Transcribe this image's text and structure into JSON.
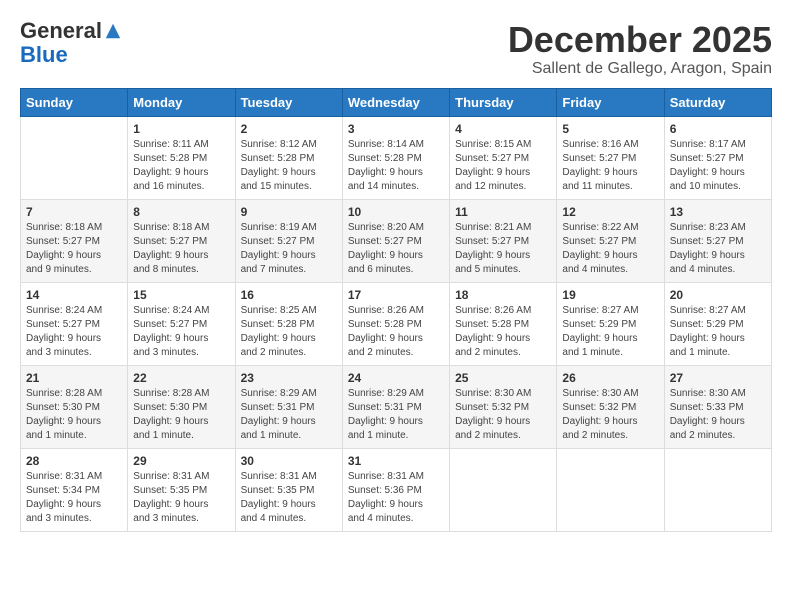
{
  "logo": {
    "general": "General",
    "blue": "Blue"
  },
  "header": {
    "month_year": "December 2025",
    "location": "Sallent de Gallego, Aragon, Spain"
  },
  "weekdays": [
    "Sunday",
    "Monday",
    "Tuesday",
    "Wednesday",
    "Thursday",
    "Friday",
    "Saturday"
  ],
  "weeks": [
    [
      {
        "day": "",
        "info": ""
      },
      {
        "day": "1",
        "info": "Sunrise: 8:11 AM\nSunset: 5:28 PM\nDaylight: 9 hours\nand 16 minutes."
      },
      {
        "day": "2",
        "info": "Sunrise: 8:12 AM\nSunset: 5:28 PM\nDaylight: 9 hours\nand 15 minutes."
      },
      {
        "day": "3",
        "info": "Sunrise: 8:14 AM\nSunset: 5:28 PM\nDaylight: 9 hours\nand 14 minutes."
      },
      {
        "day": "4",
        "info": "Sunrise: 8:15 AM\nSunset: 5:27 PM\nDaylight: 9 hours\nand 12 minutes."
      },
      {
        "day": "5",
        "info": "Sunrise: 8:16 AM\nSunset: 5:27 PM\nDaylight: 9 hours\nand 11 minutes."
      },
      {
        "day": "6",
        "info": "Sunrise: 8:17 AM\nSunset: 5:27 PM\nDaylight: 9 hours\nand 10 minutes."
      }
    ],
    [
      {
        "day": "7",
        "info": "Sunrise: 8:18 AM\nSunset: 5:27 PM\nDaylight: 9 hours\nand 9 minutes."
      },
      {
        "day": "8",
        "info": "Sunrise: 8:18 AM\nSunset: 5:27 PM\nDaylight: 9 hours\nand 8 minutes."
      },
      {
        "day": "9",
        "info": "Sunrise: 8:19 AM\nSunset: 5:27 PM\nDaylight: 9 hours\nand 7 minutes."
      },
      {
        "day": "10",
        "info": "Sunrise: 8:20 AM\nSunset: 5:27 PM\nDaylight: 9 hours\nand 6 minutes."
      },
      {
        "day": "11",
        "info": "Sunrise: 8:21 AM\nSunset: 5:27 PM\nDaylight: 9 hours\nand 5 minutes."
      },
      {
        "day": "12",
        "info": "Sunrise: 8:22 AM\nSunset: 5:27 PM\nDaylight: 9 hours\nand 4 minutes."
      },
      {
        "day": "13",
        "info": "Sunrise: 8:23 AM\nSunset: 5:27 PM\nDaylight: 9 hours\nand 4 minutes."
      }
    ],
    [
      {
        "day": "14",
        "info": "Sunrise: 8:24 AM\nSunset: 5:27 PM\nDaylight: 9 hours\nand 3 minutes."
      },
      {
        "day": "15",
        "info": "Sunrise: 8:24 AM\nSunset: 5:27 PM\nDaylight: 9 hours\nand 3 minutes."
      },
      {
        "day": "16",
        "info": "Sunrise: 8:25 AM\nSunset: 5:28 PM\nDaylight: 9 hours\nand 2 minutes."
      },
      {
        "day": "17",
        "info": "Sunrise: 8:26 AM\nSunset: 5:28 PM\nDaylight: 9 hours\nand 2 minutes."
      },
      {
        "day": "18",
        "info": "Sunrise: 8:26 AM\nSunset: 5:28 PM\nDaylight: 9 hours\nand 2 minutes."
      },
      {
        "day": "19",
        "info": "Sunrise: 8:27 AM\nSunset: 5:29 PM\nDaylight: 9 hours\nand 1 minute."
      },
      {
        "day": "20",
        "info": "Sunrise: 8:27 AM\nSunset: 5:29 PM\nDaylight: 9 hours\nand 1 minute."
      }
    ],
    [
      {
        "day": "21",
        "info": "Sunrise: 8:28 AM\nSunset: 5:30 PM\nDaylight: 9 hours\nand 1 minute."
      },
      {
        "day": "22",
        "info": "Sunrise: 8:28 AM\nSunset: 5:30 PM\nDaylight: 9 hours\nand 1 minute."
      },
      {
        "day": "23",
        "info": "Sunrise: 8:29 AM\nSunset: 5:31 PM\nDaylight: 9 hours\nand 1 minute."
      },
      {
        "day": "24",
        "info": "Sunrise: 8:29 AM\nSunset: 5:31 PM\nDaylight: 9 hours\nand 1 minute."
      },
      {
        "day": "25",
        "info": "Sunrise: 8:30 AM\nSunset: 5:32 PM\nDaylight: 9 hours\nand 2 minutes."
      },
      {
        "day": "26",
        "info": "Sunrise: 8:30 AM\nSunset: 5:32 PM\nDaylight: 9 hours\nand 2 minutes."
      },
      {
        "day": "27",
        "info": "Sunrise: 8:30 AM\nSunset: 5:33 PM\nDaylight: 9 hours\nand 2 minutes."
      }
    ],
    [
      {
        "day": "28",
        "info": "Sunrise: 8:31 AM\nSunset: 5:34 PM\nDaylight: 9 hours\nand 3 minutes."
      },
      {
        "day": "29",
        "info": "Sunrise: 8:31 AM\nSunset: 5:35 PM\nDaylight: 9 hours\nand 3 minutes."
      },
      {
        "day": "30",
        "info": "Sunrise: 8:31 AM\nSunset: 5:35 PM\nDaylight: 9 hours\nand 4 minutes."
      },
      {
        "day": "31",
        "info": "Sunrise: 8:31 AM\nSunset: 5:36 PM\nDaylight: 9 hours\nand 4 minutes."
      },
      {
        "day": "",
        "info": ""
      },
      {
        "day": "",
        "info": ""
      },
      {
        "day": "",
        "info": ""
      }
    ]
  ]
}
